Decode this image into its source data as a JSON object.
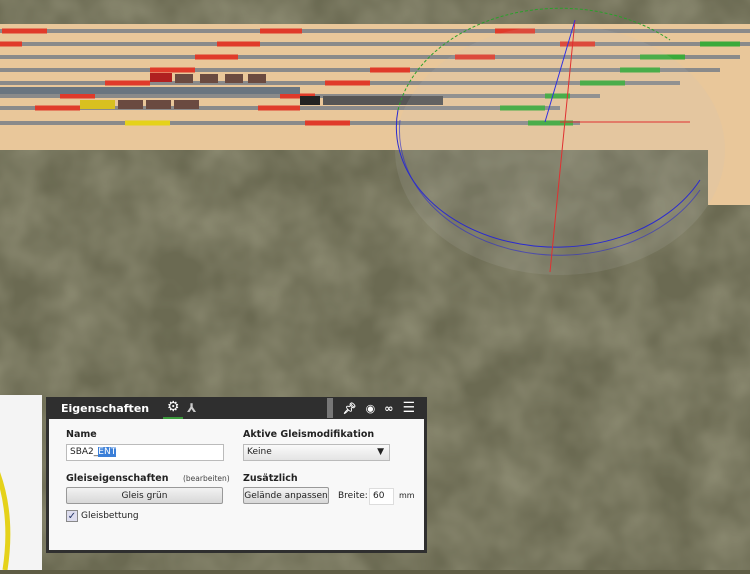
{
  "panel": {
    "title": "Eigenschaften",
    "tabs": [
      "settings-gear",
      "hierarchy"
    ],
    "header_icons": [
      "pin",
      "eye",
      "link",
      "menu"
    ]
  },
  "name": {
    "label": "Name",
    "value_plain": "SBA2_",
    "value_selected": "ENT"
  },
  "modification": {
    "label": "Aktive Gleismodifikation",
    "selected": "Keine"
  },
  "track_props": {
    "label": "Gleiseigenschaften",
    "edit_link": "(bearbeiten)",
    "button": "Gleis grün"
  },
  "bedding": {
    "label": "Gleisbettung",
    "checked": true
  },
  "extra": {
    "label": "Zusätzlich",
    "button": "Gelände anpassen",
    "width_label": "Breite:",
    "width_value": "60",
    "unit": "mm"
  },
  "colors": {
    "board": "#e9c79a",
    "terrain": "#5e5c44",
    "occupied": "#e03a2a",
    "free": "#3aaa3a",
    "selected": "#e5d21a"
  }
}
